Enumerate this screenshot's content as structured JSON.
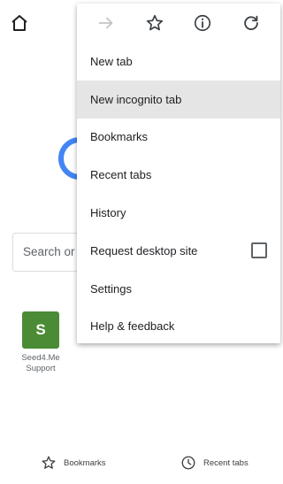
{
  "page": {
    "search_placeholder": "Search or t",
    "tile": {
      "letter": "S",
      "label": "Seed4.Me Support"
    }
  },
  "bottom_bar": {
    "bookmarks_label": "Bookmarks",
    "recent_tabs_label": "Recent tabs"
  },
  "menu": {
    "items": [
      {
        "label": "New tab"
      },
      {
        "label": "New incognito tab"
      },
      {
        "label": "Bookmarks"
      },
      {
        "label": "Recent tabs"
      },
      {
        "label": "History"
      },
      {
        "label": "Request desktop site",
        "checkbox": false
      },
      {
        "label": "Settings"
      },
      {
        "label": "Help & feedback"
      }
    ]
  },
  "colors": {
    "tile_bg": "#4b8b35",
    "logo_ring": "#4285f4",
    "highlight_bg": "#e5e5e5"
  },
  "icons": {
    "toolbar": [
      "forward-icon",
      "star-icon",
      "info-icon",
      "refresh-icon"
    ],
    "home": "home-icon"
  }
}
